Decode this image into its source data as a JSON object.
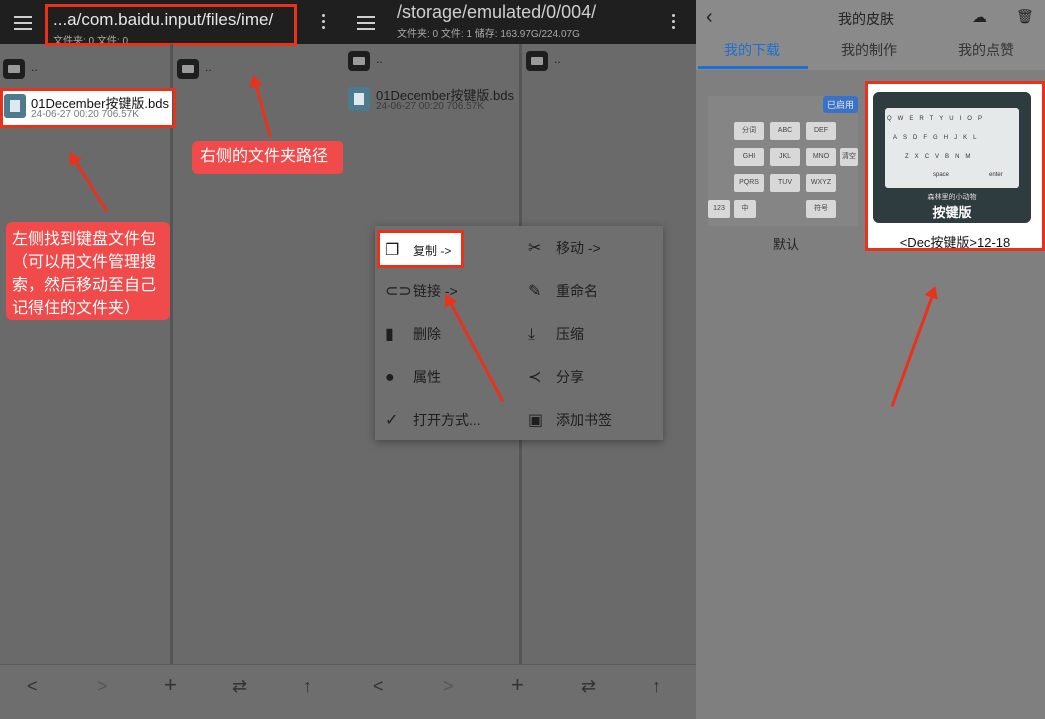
{
  "panel1": {
    "path": "...a/com.baidu.input/files/ime/",
    "subinfo": "文件夹: 0  文件: 0",
    "left_parent": "..",
    "right_parent": "..",
    "file": {
      "name": "01December按键版.bds",
      "meta": "24-06-27 00:20  706.57K"
    },
    "callout_left": "左侧找到键盘文件包（可以用文件管理搜索，然后移动至自己记得住的文件夹）",
    "callout_right": "右侧的文件夹路径"
  },
  "panel2": {
    "path": "/storage/emulated/0/004/",
    "subinfo": "文件夹: 0  文件: 1  储存: 163.97G/224.07G",
    "left_parent": "..",
    "right_parent": "..",
    "file": {
      "name": "01December按键版.bds",
      "meta": "24-06-27 00:20  706.57K"
    },
    "menu": {
      "copy": "复制 ->",
      "move": "移动 ->",
      "link": "链接 ->",
      "rename": "重命名",
      "delete": "删除",
      "compress": "压缩",
      "properties": "属性",
      "share": "分享",
      "open_with": "打开方式...",
      "bookmark": "添加书签"
    }
  },
  "bottom_nav": {
    "back": "<",
    "forward": ">",
    "add": "+",
    "swap": "⇄",
    "up": "↑"
  },
  "panel3": {
    "title": "我的皮肤",
    "tabs": [
      "我的下载",
      "我的制作",
      "我的点赞"
    ],
    "active_tab": "我的下载",
    "default_badge": "已启用",
    "default_label": "默认",
    "skin_label": "<Dec按键版>12-18",
    "skin_text_small": "森林里的小动物",
    "skin_text_big": "按键版",
    "default_keys": [
      "分词",
      "ABC",
      "DEF",
      "GHI",
      "JKL",
      "MNO",
      "PQRS",
      "TUV",
      "WXYZ",
      "123",
      "中",
      "符号",
      "清空"
    ],
    "skin_keys_row1": [
      "Q",
      "W",
      "E",
      "R",
      "T",
      "Y",
      "U",
      "I",
      "O",
      "P"
    ],
    "skin_keys_row2": [
      "A",
      "S",
      "D",
      "F",
      "G",
      "H",
      "J",
      "K",
      "L"
    ],
    "skin_keys_row3": [
      "Z",
      "X",
      "C",
      "V",
      "B",
      "N",
      "M"
    ],
    "skin_space": "space",
    "skin_enter": "enter"
  },
  "colors": {
    "accent_red": "#e8321c",
    "tab_blue": "#1f6fd1",
    "callout": "#f04a4a"
  }
}
